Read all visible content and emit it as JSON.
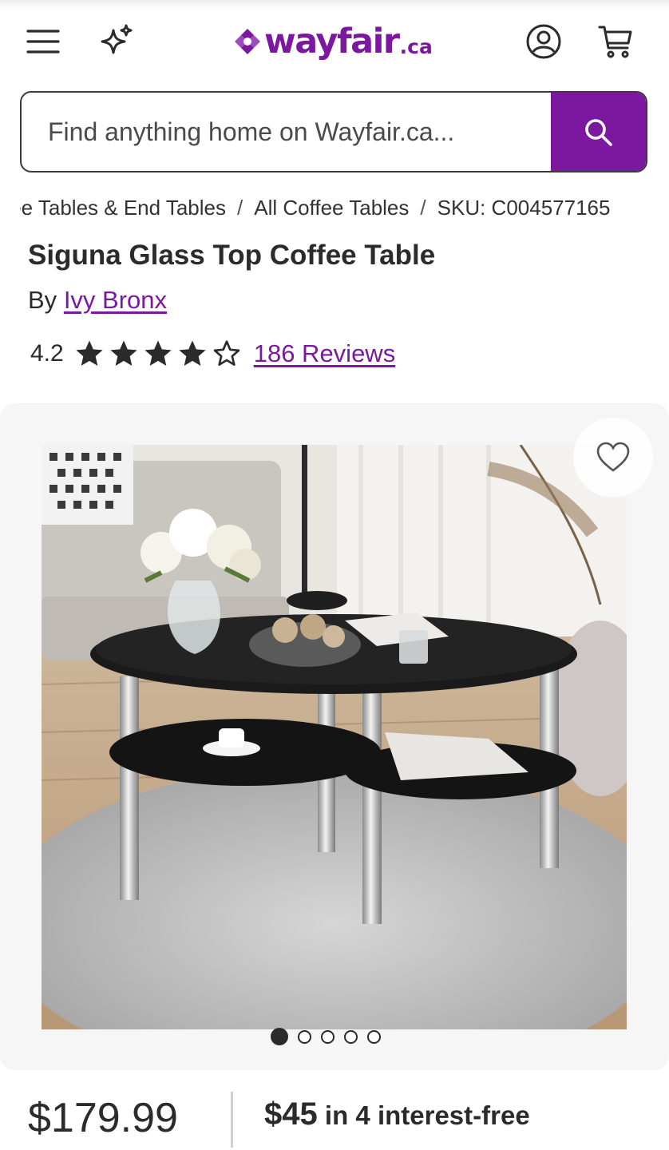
{
  "header": {
    "logo_text": "wayfair",
    "logo_suffix": ".ca",
    "icons": [
      "menu-icon",
      "sparkle-icon",
      "account-icon",
      "cart-icon"
    ]
  },
  "search": {
    "placeholder": "Find anything home on Wayfair.ca..."
  },
  "breadcrumb": {
    "items": [
      "Coffee Tables & End Tables",
      "All Coffee Tables",
      "SKU: C004577165"
    ]
  },
  "product": {
    "title": "Siguna Glass Top Coffee Table",
    "by_label": "By",
    "brand": "Ivy Bronx",
    "rating": "4.2",
    "rating_value": 4.2,
    "reviews": "186 Reviews",
    "price": "$179.99",
    "installment_amount": "$45",
    "installment_text": "in 4 interest-free"
  },
  "gallery": {
    "image_count": 5,
    "active_index": 0
  },
  "colors": {
    "brand_purple": "#7b189f",
    "text": "#2b2b2b"
  }
}
